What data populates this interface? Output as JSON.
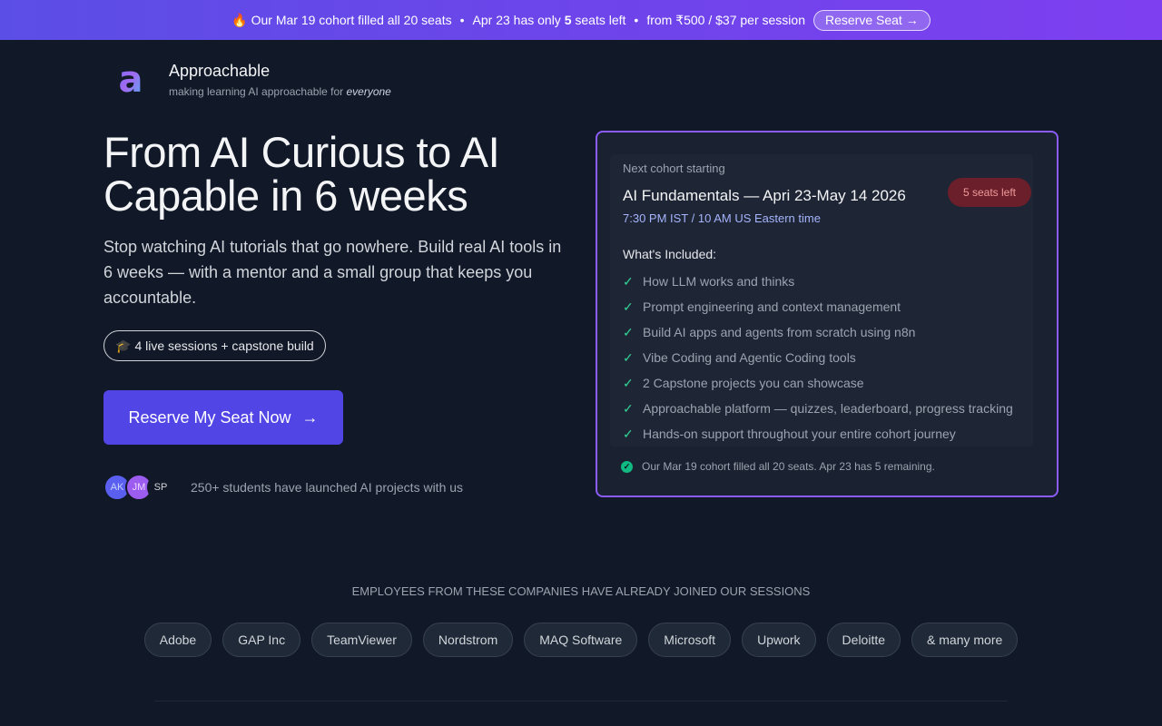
{
  "banner": {
    "part1": "🔥 Our Mar 19 cohort filled all 20 seats",
    "bullet": "•",
    "part2_pre": "Apr 23 has only ",
    "part2_num": "5",
    "part2_post": " seats left",
    "part3": "from ₹500 / $37 per session",
    "button": "Reserve Seat →"
  },
  "brand": {
    "name": "Approachable",
    "tagline_pre": "making learning AI approachable for ",
    "tagline_em": "everyone"
  },
  "hero": {
    "title": "From AI Curious to AI Capable in 6 weeks",
    "subtitle": "Stop watching AI tutorials that go nowhere. Build real AI tools in 6 weeks — with a mentor and a small group that keeps you accountable.",
    "pill_icon": "🎓",
    "pill_text": "4 live sessions + capstone build",
    "cta_label": "Reserve My Seat Now",
    "cta_arrow": "→",
    "avatars": [
      "AK",
      "JM",
      "SP"
    ],
    "social_text": "250+ students have launched AI projects with us"
  },
  "card": {
    "label": "Next cohort starting",
    "title": "AI Fundamentals — Apri 23-May 14 2026",
    "time": "7:30 PM IST / 10 AM US Eastern time",
    "seats_badge": "5 seats left",
    "included_heading": "What's Included:",
    "check_icon": "✓",
    "items": [
      "How LLM works and thinks",
      "Prompt engineering and context management",
      "Build AI apps and agents from scratch using n8n",
      "Vibe Coding and Agentic Coding tools",
      "2 Capstone projects you can showcase",
      "Approachable platform — quizzes, leaderboard, progress tracking",
      "Hands-on support throughout your entire cohort journey"
    ],
    "footer": "Our Mar 19 cohort filled all 20 seats. Apr 23 has 5 remaining."
  },
  "companies": {
    "heading": "EMPLOYEES FROM THESE COMPANIES HAVE ALREADY JOINED OUR SESSIONS",
    "list": [
      "Adobe",
      "GAP Inc",
      "TeamViewer",
      "Nordstrom",
      "MAQ Software",
      "Microsoft",
      "Upwork",
      "Deloitte",
      "& many more"
    ]
  },
  "colors": {
    "banner_start": "#5b4ee6",
    "banner_end": "#7e3ff0",
    "cta": "#5145e5",
    "card_border": "#8b5cf6",
    "check": "#34d399",
    "seats_badge_bg": "#6b1f2a"
  }
}
